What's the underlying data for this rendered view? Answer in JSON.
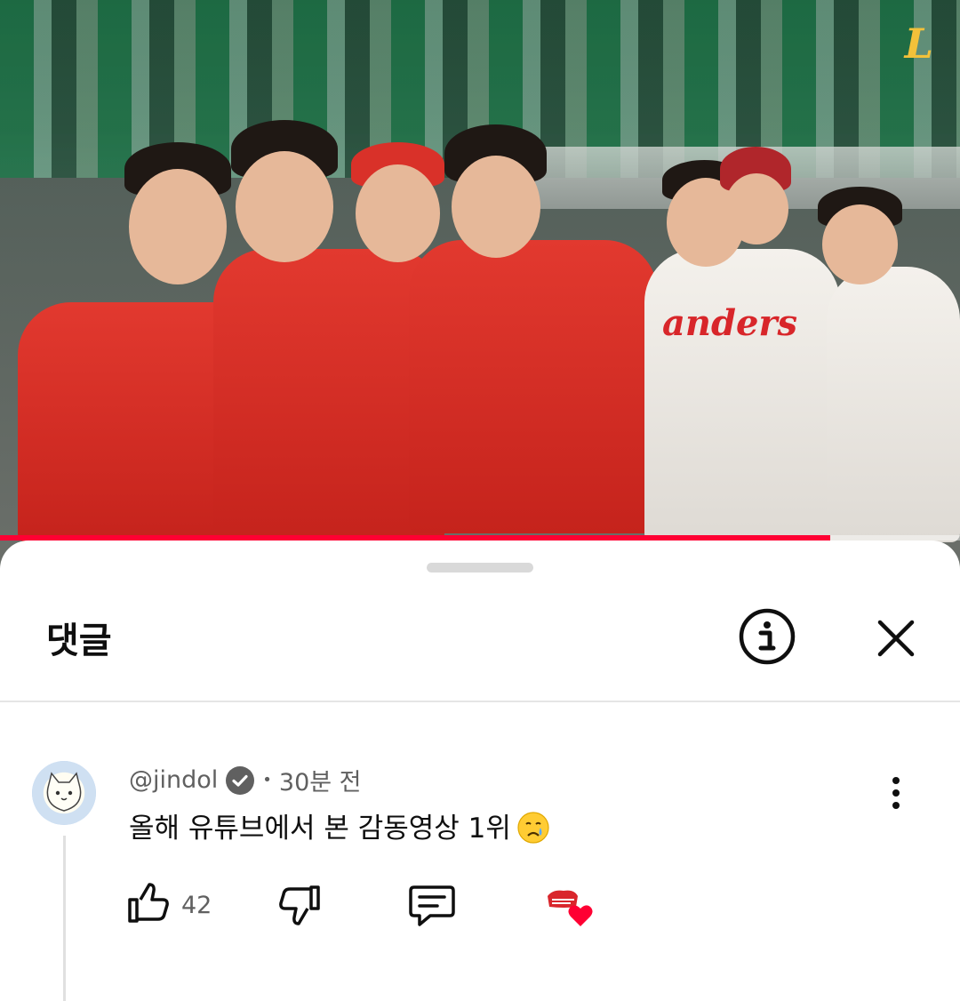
{
  "video": {
    "progress_fraction": 0.865,
    "progress_color": "#ff0033",
    "corner_logo": "L",
    "jersey_text": "anders"
  },
  "comments_panel": {
    "title": "댓글",
    "info_icon": "info-icon",
    "close_icon": "close-icon"
  },
  "comment": {
    "author": "@jindol",
    "verified_icon": "verified-check-icon",
    "separator": "•",
    "time": "30분 전",
    "text": "올해 유튜브에서 본 감동영상 1위",
    "emoji": "crying-face-emoji",
    "like_count": "42",
    "like_icon": "thumbs-up-icon",
    "dislike_icon": "thumbs-down-icon",
    "reply_icon": "reply-icon",
    "creator_heart": "creator-heart-icon",
    "more_icon": "more-vertical-icon"
  }
}
